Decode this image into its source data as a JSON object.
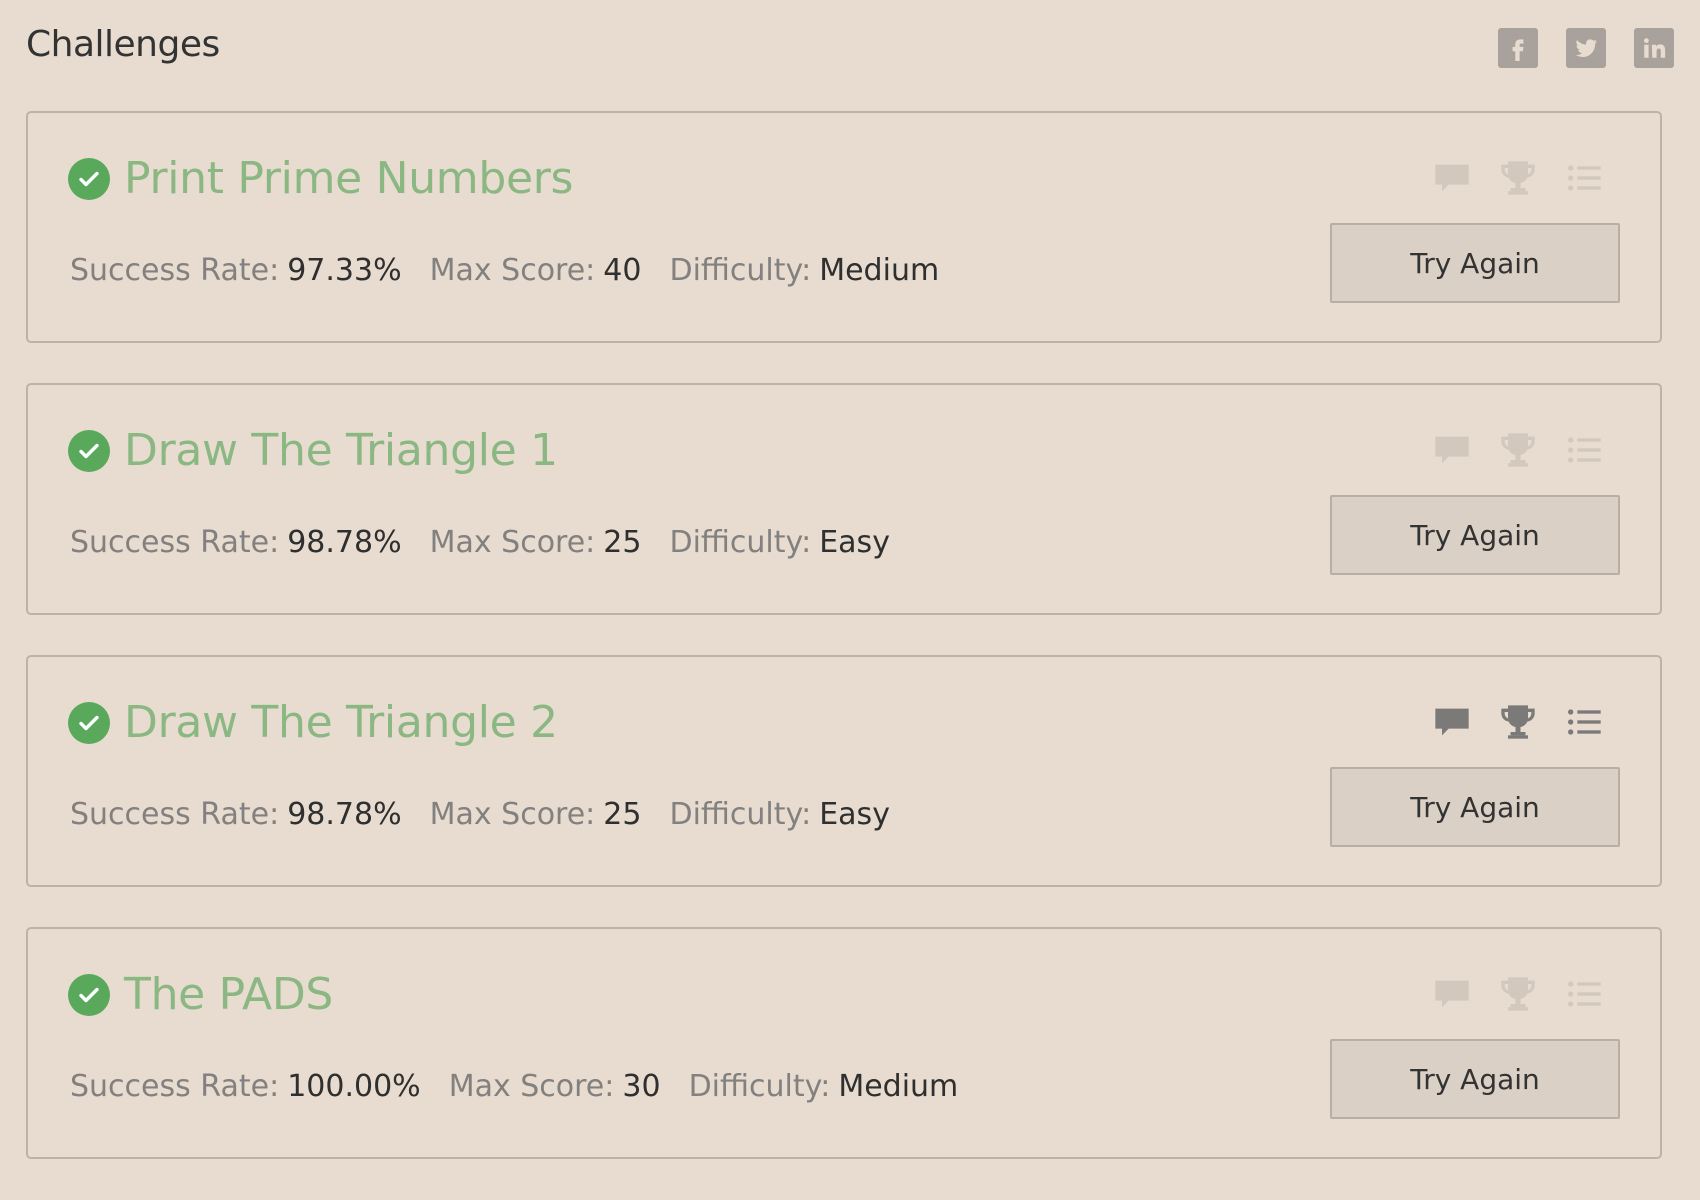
{
  "header": {
    "title": "Challenges",
    "social": [
      {
        "icon": "facebook-icon"
      },
      {
        "icon": "twitter-icon"
      },
      {
        "icon": "linkedin-icon"
      }
    ]
  },
  "labels": {
    "success_rate": "Success Rate:",
    "max_score": "Max Score:",
    "difficulty": "Difficulty:"
  },
  "challenges": [
    {
      "title": "Print Prime Numbers",
      "success_rate": "97.33%",
      "max_score": "40",
      "difficulty": "Medium",
      "button": "Try Again",
      "icons_highlighted": false
    },
    {
      "title": "Draw The Triangle 1",
      "success_rate": "98.78%",
      "max_score": "25",
      "difficulty": "Easy",
      "button": "Try Again",
      "icons_highlighted": false
    },
    {
      "title": "Draw The Triangle 2",
      "success_rate": "98.78%",
      "max_score": "25",
      "difficulty": "Easy",
      "button": "Try Again",
      "icons_highlighted": true
    },
    {
      "title": "The PADS",
      "success_rate": "100.00%",
      "max_score": "30",
      "difficulty": "Medium",
      "button": "Try Again",
      "icons_highlighted": false
    }
  ],
  "colors": {
    "background": "#e7dccf",
    "title_green": "#8bb783",
    "check_green": "#5aa85c",
    "icon_faded": "#d2c8bd",
    "icon_dark": "#7c7a79"
  }
}
